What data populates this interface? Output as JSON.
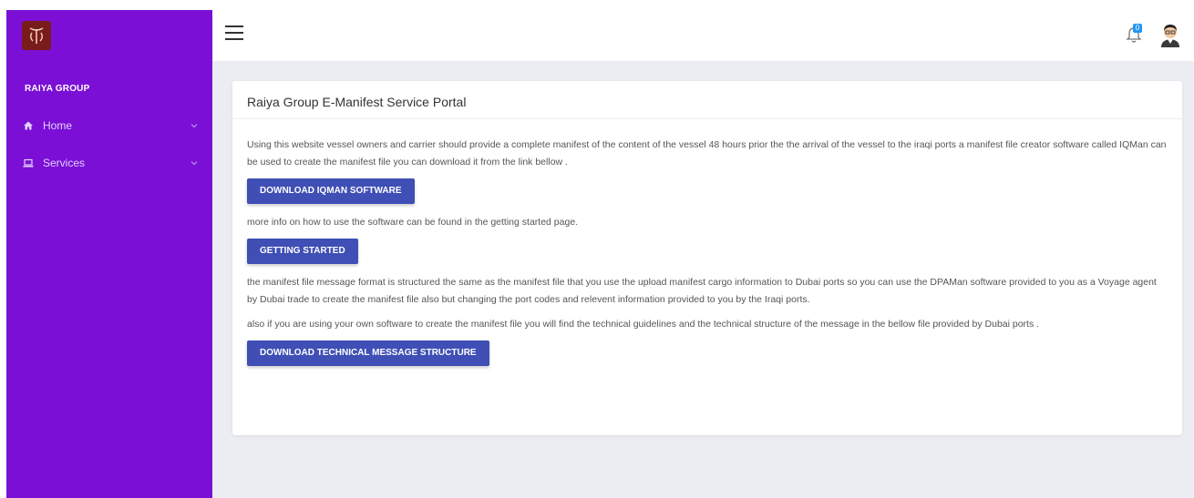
{
  "brand": {
    "name": "RAIYA GROUP",
    "logo_icon": "raiya-logo-icon"
  },
  "sidebar": {
    "items": [
      {
        "label": "Home",
        "icon": "home-icon"
      },
      {
        "label": "Services",
        "icon": "laptop-icon"
      }
    ]
  },
  "topbar": {
    "notification_count": "0"
  },
  "card": {
    "title": "Raiya Group E-Manifest Service Portal",
    "paragraphs": [
      "Using this website vessel owners and carrier should provide a complete manifest of the content of the vessel 48 hours prior the the arrival of the vessel to the iraqi ports a manifest file creator software called IQMan can be used to create the manifest file you can download it from the link bellow .",
      "more info on how to use the software can be found in the getting started page.",
      "the manifest file message format is structured the same as the manifest file that you use the upload manifest cargo information to Dubai ports so you can use the DPAMan software provided to you as a Voyage agent by Dubai trade to create the manifest file also but changing the port codes and relevent information provided to you by the Iraqi ports.",
      "also if you are using your own software to create the manifest file you will find the technical guidelines and the technical structure of the message in the bellow file provided by Dubai ports ."
    ],
    "buttons": {
      "download_iqman": "DOWNLOAD IQMAN SOFTWARE",
      "getting_started": "GETTING STARTED",
      "download_structure": "DOWNLOAD TECHNICAL MESSAGE STRUCTURE"
    }
  },
  "colors": {
    "sidebar_bg": "#7b0fd6",
    "button_bg": "#3f4fb5",
    "content_bg": "#ebedf3",
    "logo_bg": "#7a1b1b"
  }
}
